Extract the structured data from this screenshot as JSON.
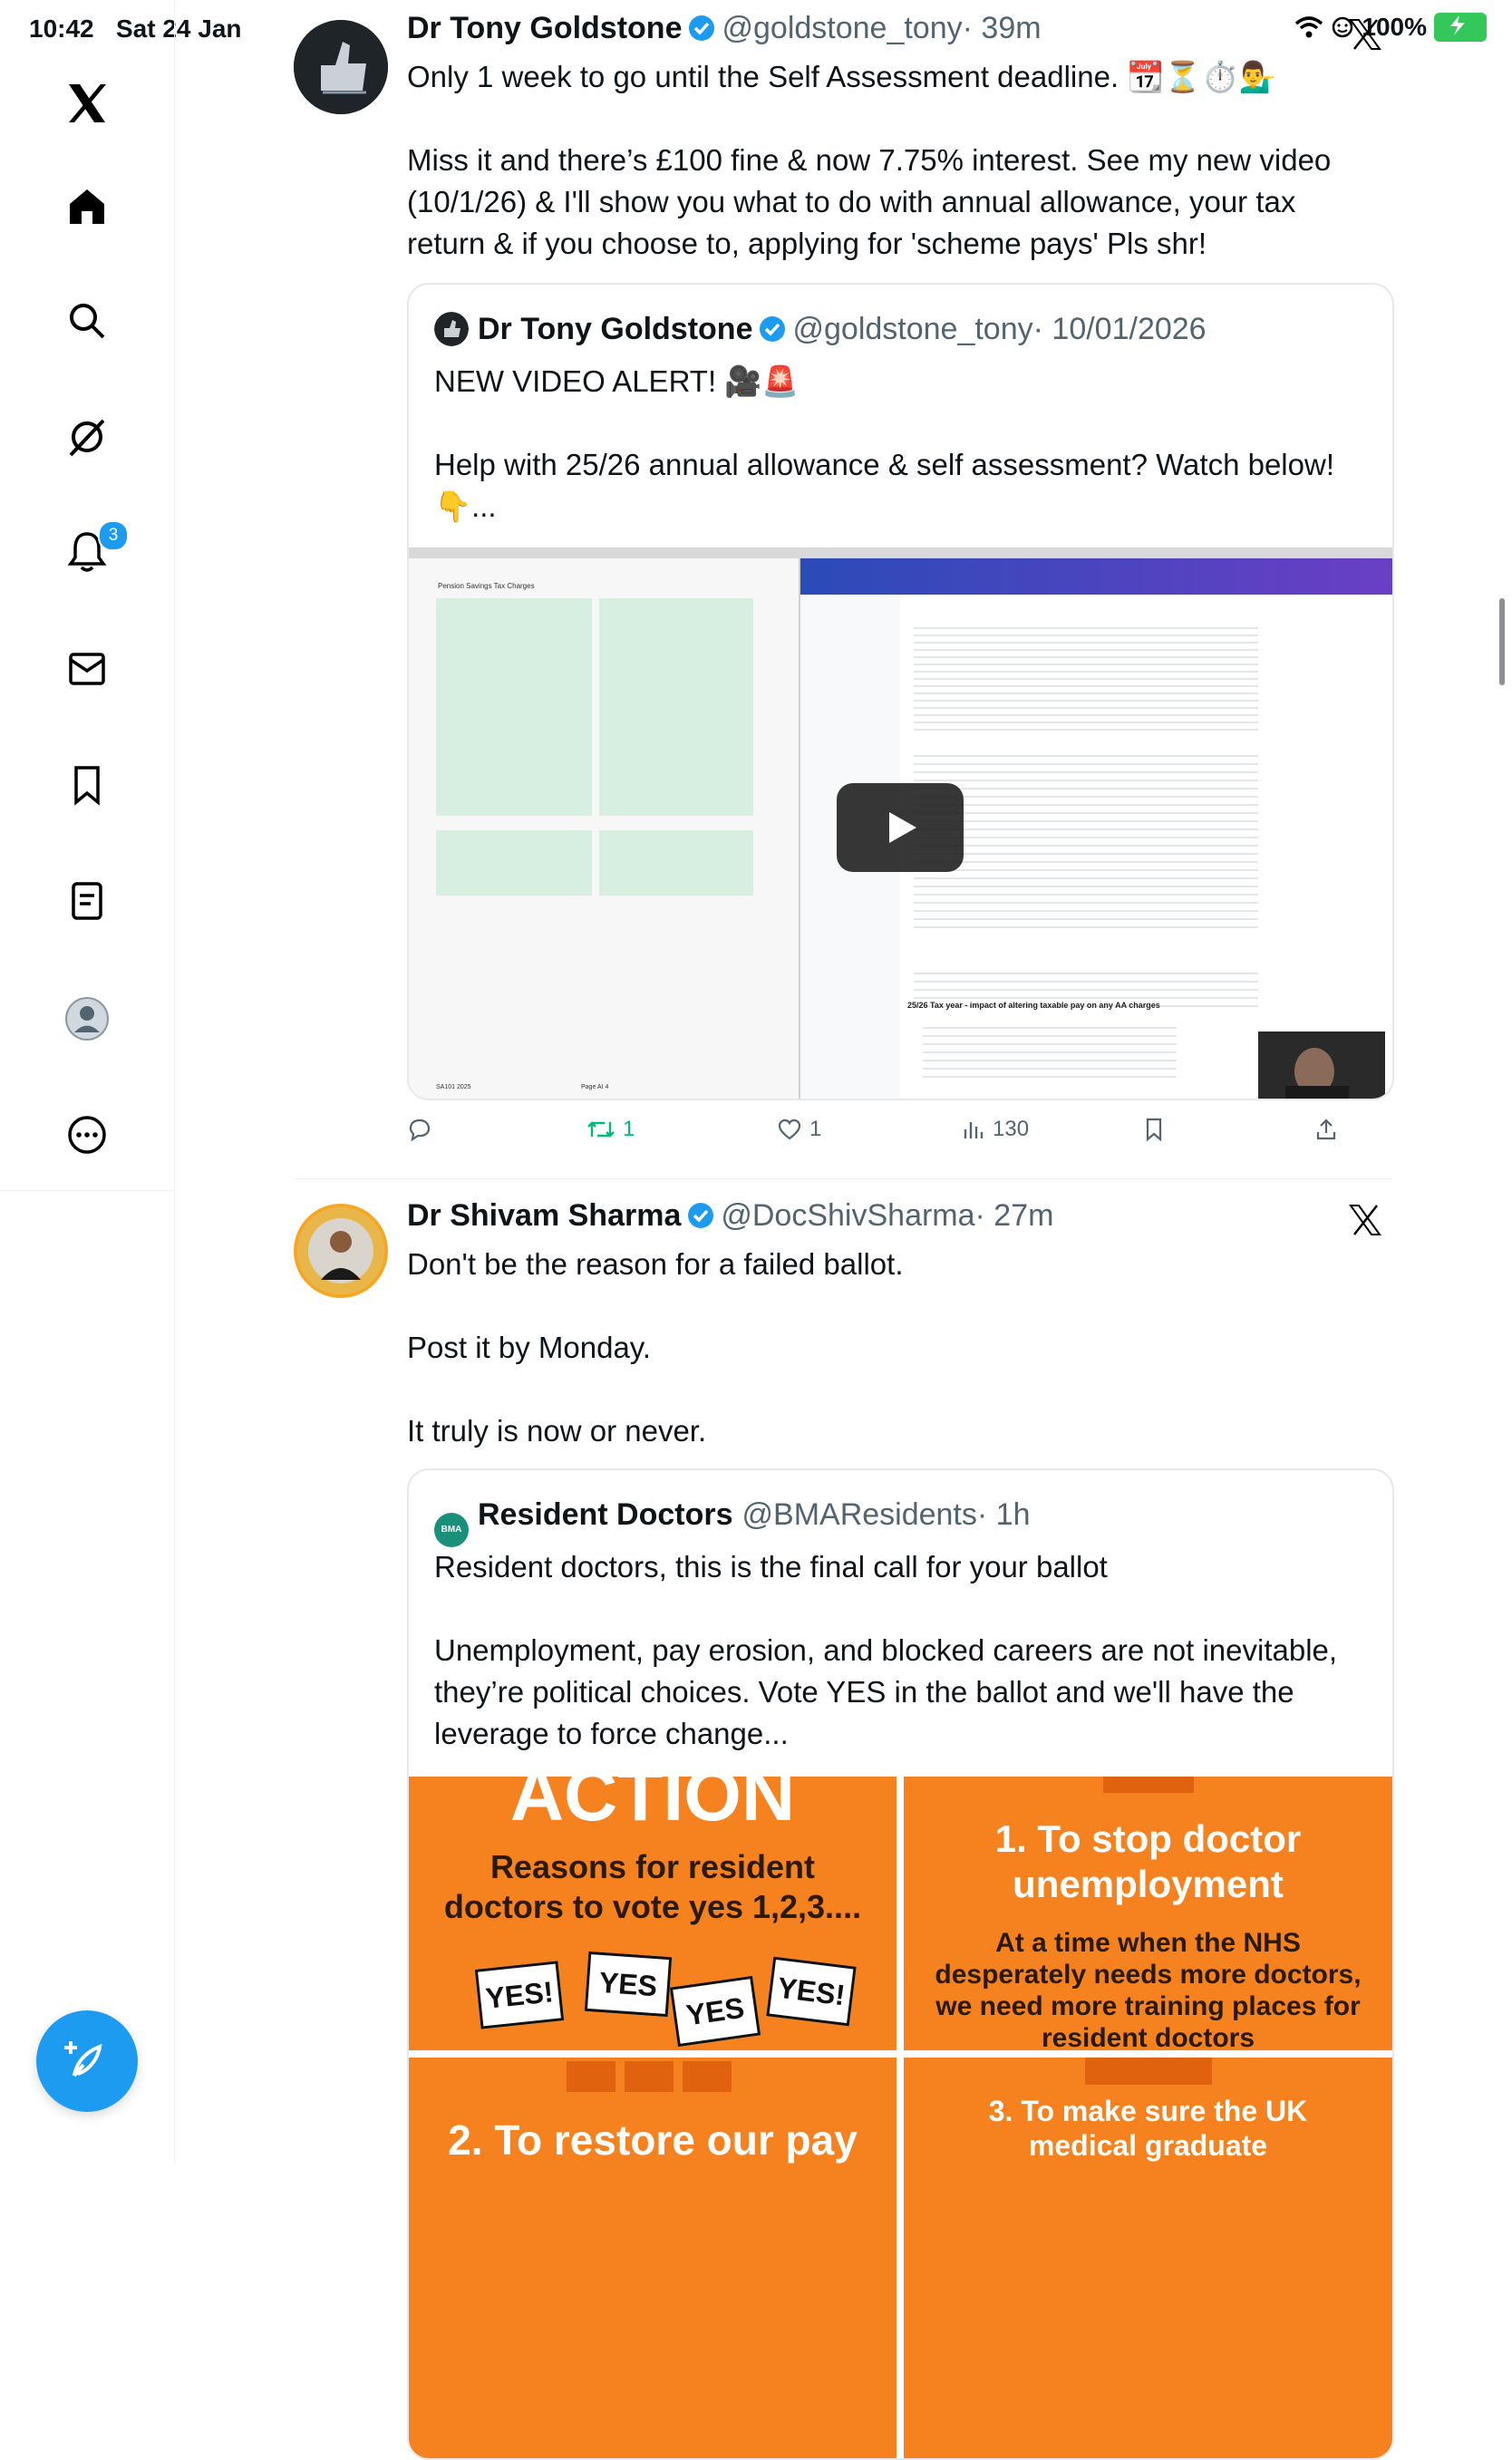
{
  "status_bar": {
    "time": "10:42",
    "date": "Sat 24 Jan",
    "battery": "100%"
  },
  "sidebar": {
    "notifications_badge": "3",
    "icons": [
      "x-logo-icon",
      "home-icon",
      "search-icon",
      "grok-icon",
      "notifications-icon",
      "messages-icon",
      "bookmarks-icon",
      "lists-icon",
      "profile-icon",
      "more-icon"
    ]
  },
  "colors": {
    "accent": "#1d9bf0",
    "orange": "#f5821f",
    "muted": "#536471",
    "retweet": "#00ba7c"
  },
  "tweets": [
    {
      "name": "Dr Tony Goldstone",
      "handle": "@goldstone_tony",
      "time": "· 39m",
      "text": "Only 1 week to go until the Self Assessment deadline. 📆⏳⏱️💁‍♂️\n\nMiss it and there’s £100 fine & now 7.75% interest. See my new video (10/1/26) & I'll show you what to do with annual allowance, your tax return & if you choose to, applying for 'scheme pays' Pls shr!",
      "quote": {
        "name": "Dr Tony Goldstone",
        "handle": "@goldstone_tony",
        "time": "· 10/01/2026",
        "text": "NEW VIDEO ALERT! 🎥🚨\n\nHelp with 25/26 annual allowance & self assessment? Watch below! 👇...",
        "video": {
          "left_title": "Pension Savings Tax Charges",
          "left_footer": "SA101 2025",
          "left_page": "Page AI 4",
          "right_section": "25/26 Tax year - impact of altering taxable pay on any AA charges"
        }
      },
      "actions": {
        "reply": "",
        "retweet": "1",
        "like": "1",
        "views": "130"
      }
    },
    {
      "name": "Dr Shivam Sharma",
      "handle": "@DocShivSharma",
      "time": "· 27m",
      "text": "Don't be the reason for a failed ballot.\n\nPost it by Monday.\n\nIt truly is now or never.",
      "quote": {
        "name": "Resident Doctors",
        "handle": "@BMAResidents",
        "time": "· 1h",
        "avatar_text": "BMA",
        "text": "Resident doctors, this is the final call for your ballot\n\nUnemployment, pay erosion, and blocked careers are not inevitable, they’re political choices. Vote YES in the ballot and we'll have the leverage to force change...",
        "image": {
          "tile1_big": "ACTION",
          "tile1_sub": "Reasons for resident doctors to vote yes 1,2,3....",
          "signs": [
            "YES!",
            "YES",
            "YES",
            "YES!"
          ],
          "tile2_title": "1. To stop doctor unemployment",
          "tile2_body": "At a time when the NHS desperately needs more doctors, we need more training places for resident doctors",
          "tile3_title": "2. To restore our pay",
          "tile4_title": "3. To make sure the UK medical graduate"
        }
      }
    }
  ]
}
